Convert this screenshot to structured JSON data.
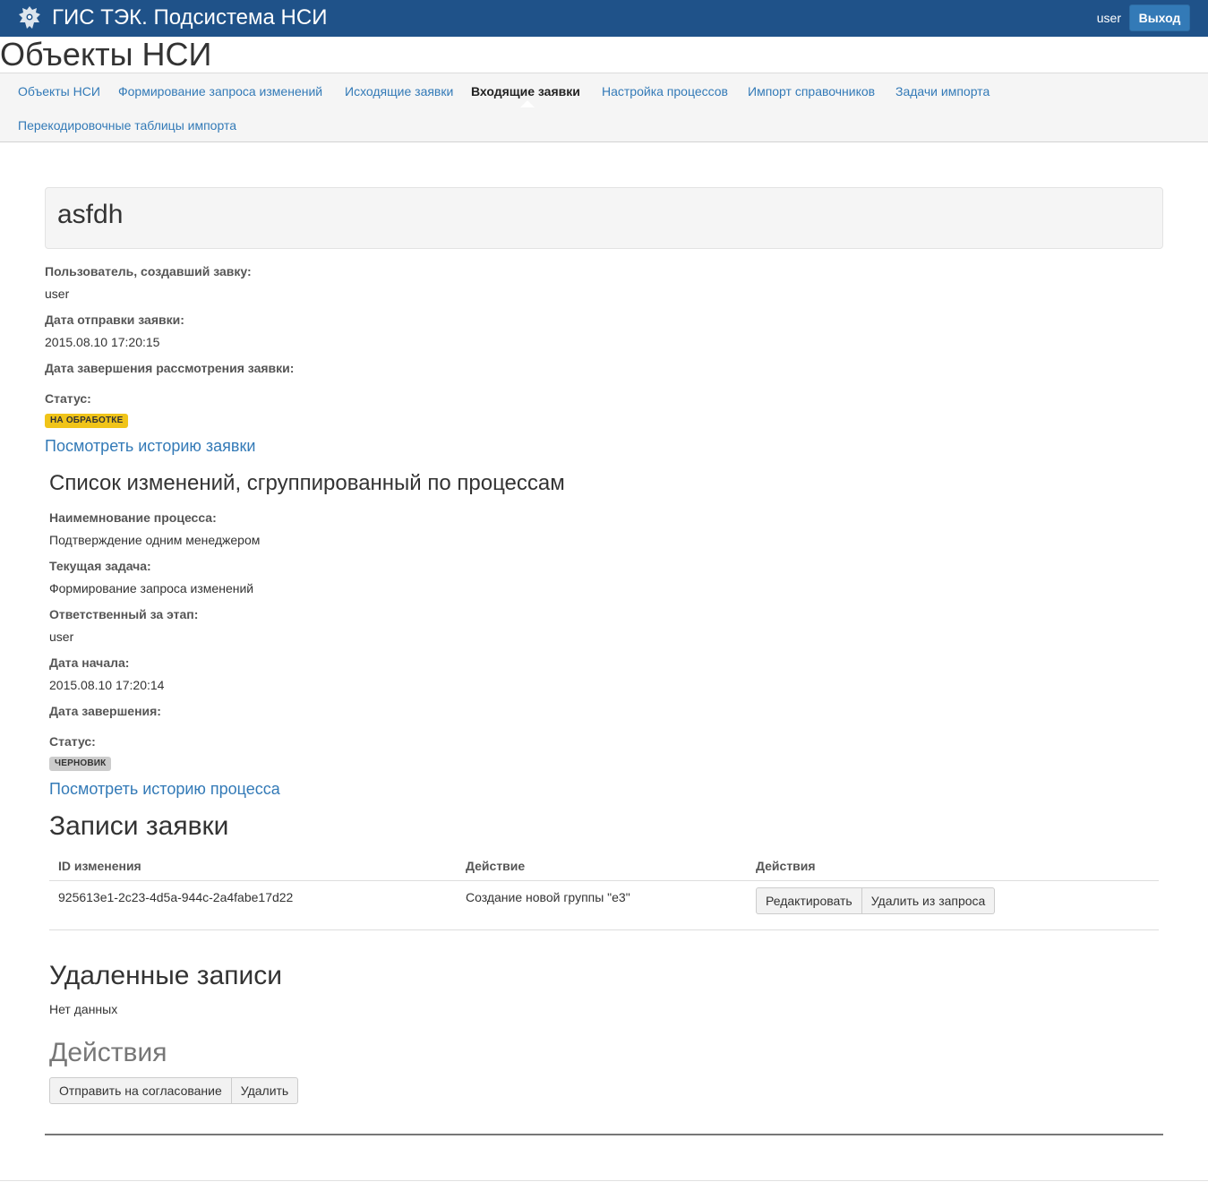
{
  "app": {
    "title": "ГИС ТЭК. Подсистема НСИ",
    "username": "user",
    "logout_label": "Выход",
    "brand_color": "#1f5289"
  },
  "page": {
    "title": "Объекты НСИ"
  },
  "nav": {
    "items": [
      {
        "label": "Объекты НСИ"
      },
      {
        "label": "Формирование запроса изменений"
      },
      {
        "label": "Исходящие заявки"
      },
      {
        "label": "Входящие заявки",
        "active": true
      },
      {
        "label": "Настройка процессов"
      },
      {
        "label": "Импорт справочников"
      },
      {
        "label": "Задачи импорта"
      },
      {
        "label": "Перекодировочные таблицы импорта"
      }
    ]
  },
  "request": {
    "name": "asfdh",
    "creator_label": "Пользователь, создавший завку:",
    "creator_value": "user",
    "sent_label": "Дата отправки заявки:",
    "sent_value": "2015.08.10 17:20:15",
    "review_end_label": "Дата завершения рассмотрения заявки:",
    "review_end_value": "",
    "status_label": "Статус:",
    "status_badge": "НА ОБРАБОТКЕ",
    "history_link": "Посмотреть историю заявки"
  },
  "processes": {
    "heading": "Список изменений, сгруппированный по процессам",
    "process_name_label": "Наимемнование процесса:",
    "process_name_value": "Подтверждение одним менеджером",
    "current_task_label": "Текущая задача:",
    "current_task_value": "Формирование запроса изменений",
    "responsible_label": "Ответственный за этап:",
    "responsible_value": "user",
    "start_label": "Дата начала:",
    "start_value": "2015.08.10 17:20:14",
    "end_label": "Дата завершения:",
    "end_value": "",
    "status_label": "Статус:",
    "status_badge": "ЧЕРНОВИК",
    "history_link": "Посмотреть историю процесса"
  },
  "records": {
    "heading": "Записи заявки",
    "columns": [
      "ID изменения",
      "Действие",
      "Действия"
    ],
    "rows": [
      {
        "id": "925613e1-2c23-4d5a-944c-2a4fabe17d22",
        "action": "Создание новой группы \"e3\"",
        "edit_label": "Редактировать",
        "remove_label": "Удалить из запроса"
      }
    ]
  },
  "deleted": {
    "heading": "Удаленные записи",
    "empty_text": "Нет данных"
  },
  "actions": {
    "heading": "Действия",
    "submit_label": "Отправить на согласование",
    "delete_label": "Удалить"
  }
}
